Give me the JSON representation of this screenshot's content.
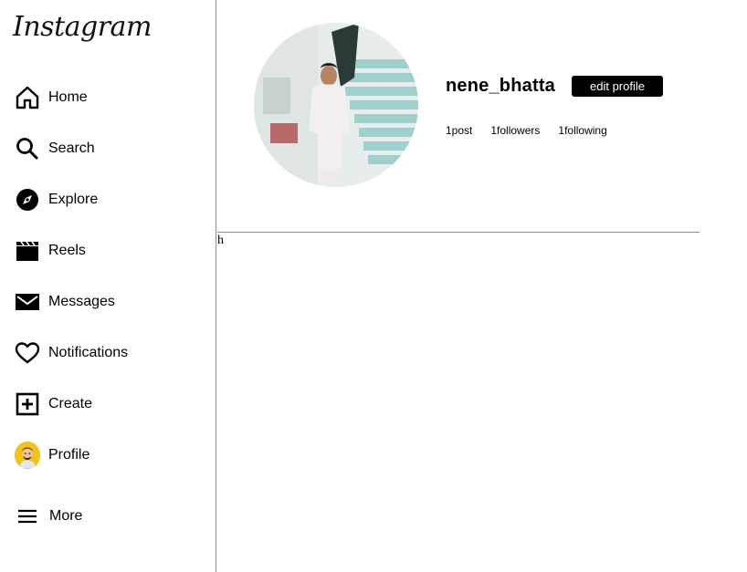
{
  "app": {
    "logo_text": "Instagram"
  },
  "sidebar": {
    "items": [
      {
        "label": "Home",
        "icon": "home-icon"
      },
      {
        "label": "Search",
        "icon": "search-icon"
      },
      {
        "label": "Explore",
        "icon": "explore-compass-icon"
      },
      {
        "label": "Reels",
        "icon": "reels-clapper-icon"
      },
      {
        "label": "Messages",
        "icon": "messages-envelope-icon"
      },
      {
        "label": "Notifications",
        "icon": "heart-icon"
      },
      {
        "label": "Create",
        "icon": "plus-square-icon"
      },
      {
        "label": "Profile",
        "icon": "avatar-icon"
      }
    ],
    "more": {
      "label": "More",
      "icon": "hamburger-menu-icon"
    }
  },
  "profile": {
    "username": "nene_bhatta",
    "edit_button_label": "edit profile",
    "stats": {
      "posts": "1post",
      "followers": "1followers",
      "following": "1following"
    }
  },
  "content": {
    "stray_text": "h"
  }
}
